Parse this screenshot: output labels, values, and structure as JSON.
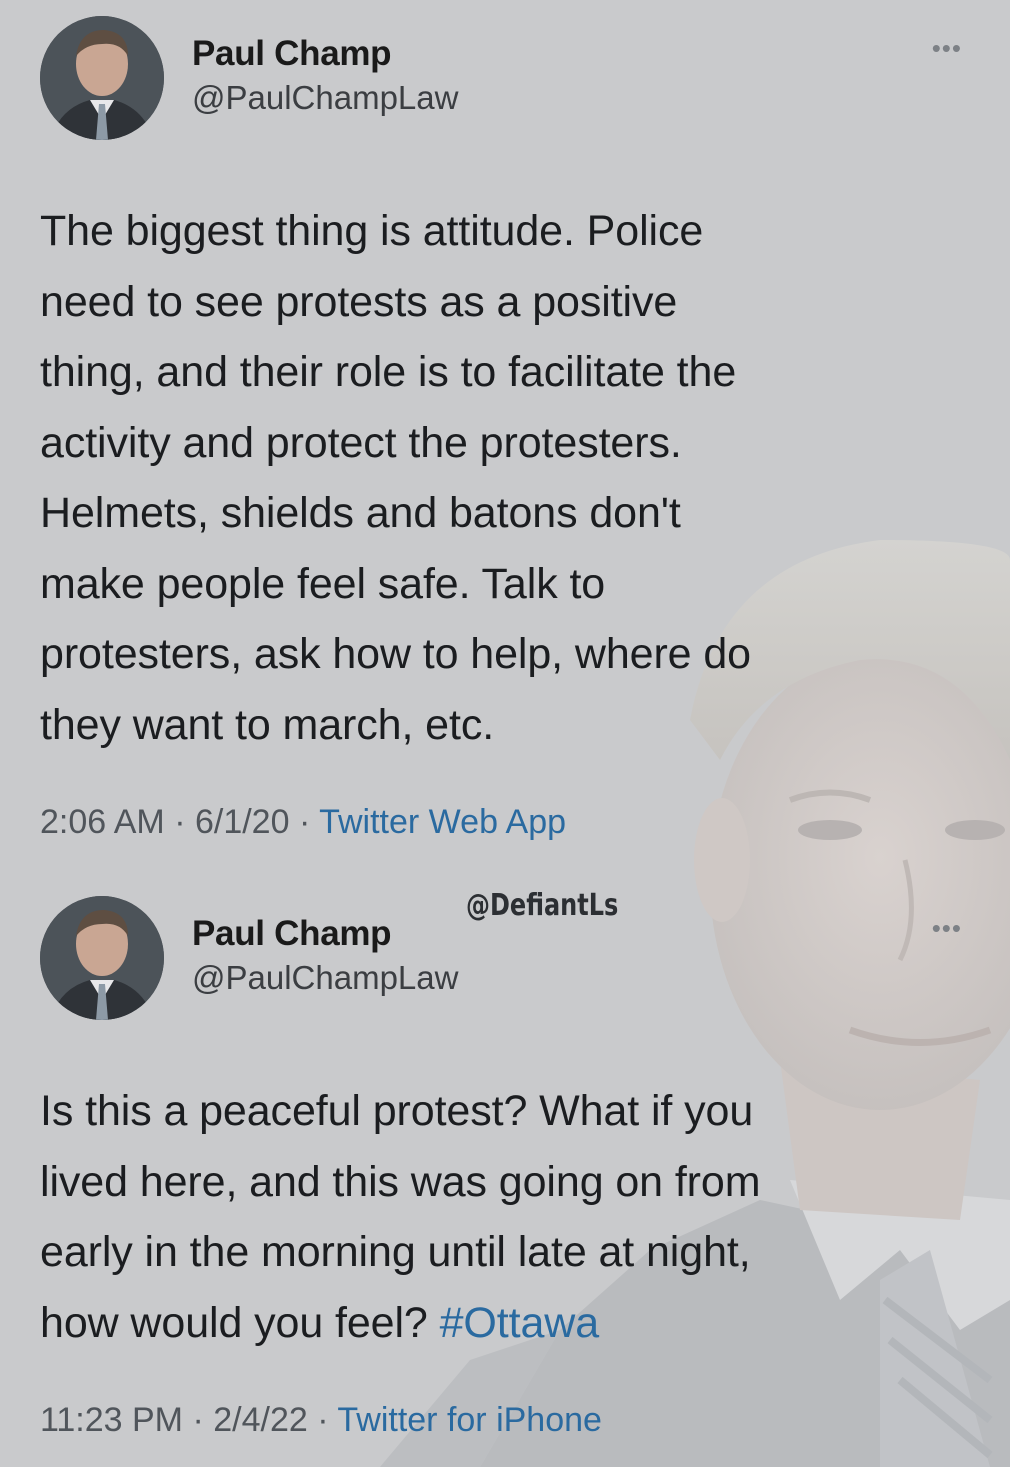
{
  "tweets": [
    {
      "display_name": "Paul Champ",
      "handle": "@PaulChampLaw",
      "more_icon": "more-options-icon",
      "lines": [
        "The biggest thing is attitude. Police",
        "need to see protests as a positive",
        "thing, and their role is to facilitate the",
        "activity and protect the protesters.",
        "Helmets, shields and batons don't",
        "make people feel safe. Talk to",
        "protesters, ask how to help, where do",
        "they want to march, etc."
      ],
      "time": "2:06 AM",
      "date": "6/1/20",
      "source": "Twitter Web App"
    },
    {
      "display_name": "Paul Champ",
      "handle": "@PaulChampLaw",
      "more_icon": "more-options-icon",
      "lines": [
        "Is this a peaceful protest? What if you",
        "lived here, and this was going on from",
        "early in the morning until late at night,"
      ],
      "last_line": "how would you feel?",
      "hashtag": "#Ottawa",
      "time": "11:23 PM",
      "date": "2/4/22",
      "source": "Twitter for iPhone"
    }
  ],
  "separator": " · ",
  "watermark": "@DefiantLs",
  "colors": {
    "background": "#c9cacc",
    "link": "#2a6aa0",
    "text": "#1b1d20"
  }
}
